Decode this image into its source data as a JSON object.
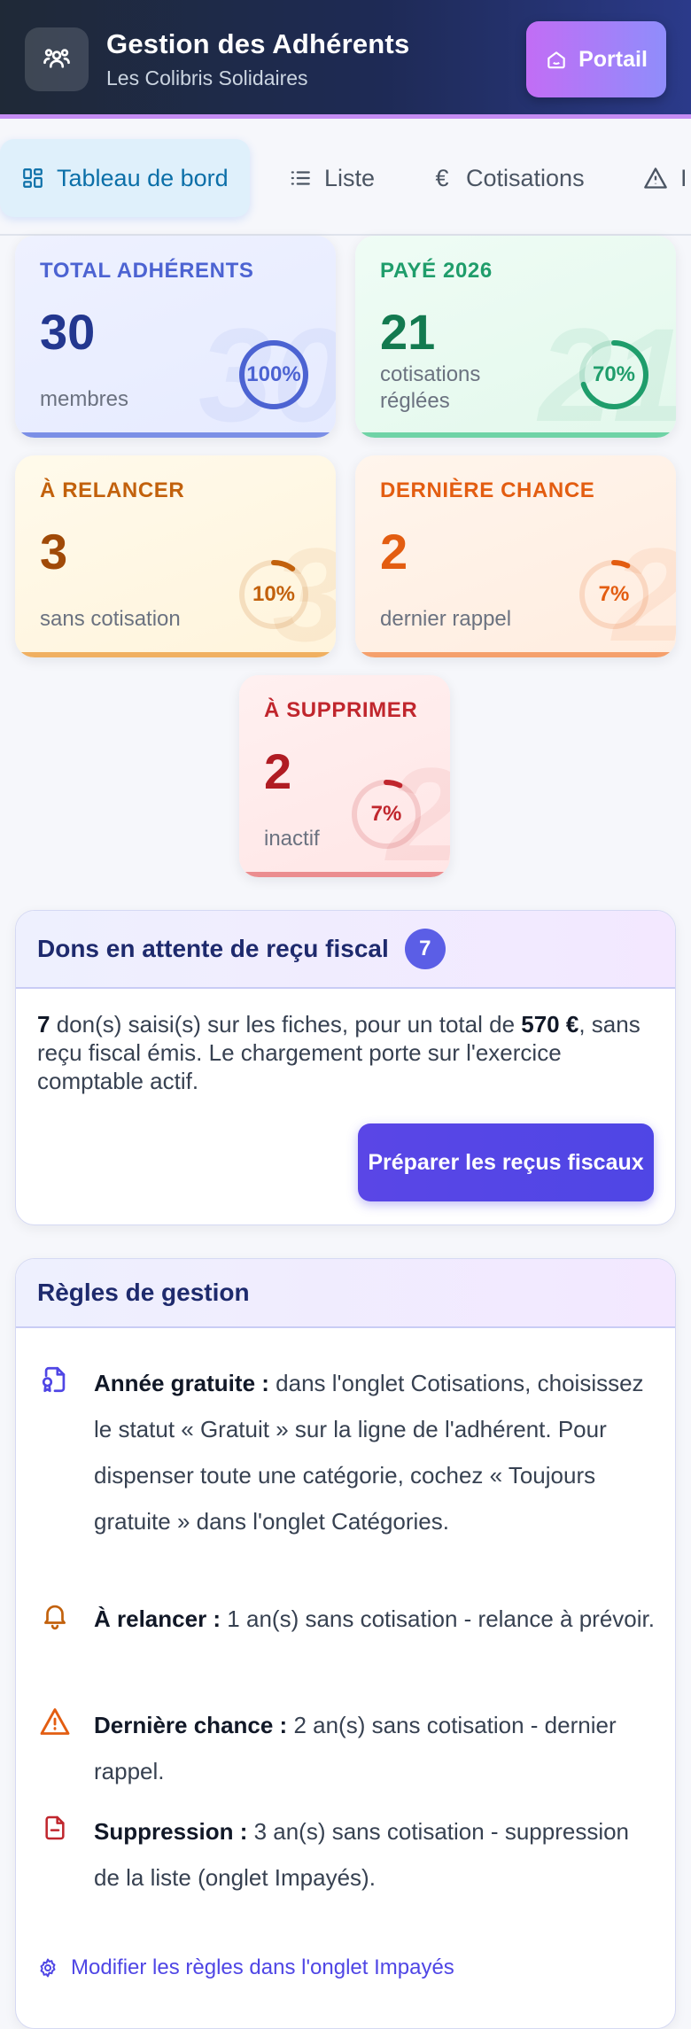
{
  "header": {
    "title": "Gestion des Adhérents",
    "subtitle": "Les Colibris Solidaires",
    "portal_label": "Portail"
  },
  "tabs": [
    {
      "label": "Tableau de bord",
      "icon": "dashboard-icon",
      "active": true
    },
    {
      "label": "Liste",
      "icon": "list-icon",
      "active": false
    },
    {
      "label": "Cotisations",
      "icon": "euro-icon",
      "active": false
    },
    {
      "label": "I",
      "icon": "warning-icon",
      "active": false
    }
  ],
  "stats": {
    "total": {
      "title": "TOTAL ADHÉRENTS",
      "value": "30",
      "label": "membres",
      "percent": 100,
      "percent_label": "100%",
      "color": "#4c63d2"
    },
    "paid": {
      "title": "PAYÉ 2026",
      "value": "21",
      "label": "cotisations réglées",
      "percent": 70,
      "percent_label": "70%",
      "color": "#1f9d6b"
    },
    "remind": {
      "title": "À RELANCER",
      "value": "3",
      "label": "sans cotisation",
      "percent": 10,
      "percent_label": "10%",
      "color": "#c2610c"
    },
    "last": {
      "title": "DERNIÈRE CHANCE",
      "value": "2",
      "label": "dernier rappel",
      "percent": 7,
      "percent_label": "7%",
      "color": "#e35d11"
    },
    "delete": {
      "title": "À SUPPRIMER",
      "value": "2",
      "label": "inactif",
      "percent": 7,
      "percent_label": "7%",
      "color": "#c0262d"
    }
  },
  "donations": {
    "title": "Dons en attente de reçu fiscal",
    "badge": "7",
    "count": "7",
    "text_1": " don(s) saisi(s) sur les fiches, pour un total de ",
    "amount": "570 €",
    "text_2": ", sans reçu fiscal émis. Le chargement porte sur l'exercice comptable actif.",
    "button": "Préparer les reçus fiscaux"
  },
  "rules": {
    "title": "Règles de gestion",
    "items": [
      {
        "label": "Année gratuite :",
        "text": " dans l'onglet Cotisations, choisissez le statut « Gratuit » sur la ligne de l'adhérent. Pour dispenser toute une catégorie, cochez « Toujours gratuite » dans l'onglet Catégories.",
        "icon": "badge-document-icon",
        "color": "#4f46e5"
      },
      {
        "label": "À relancer :",
        "text": " 1 an(s) sans cotisation - relance à prévoir.",
        "icon": "bell-icon",
        "color": "#c2610c"
      },
      {
        "label": "Dernière chance :",
        "text": " 2 an(s) sans cotisation - dernier rappel.",
        "icon": "warning-icon",
        "color": "#e35d11"
      },
      {
        "label": "Suppression :",
        "text": " 3 an(s) sans cotisation - suppression de la liste (onglet Impayés).",
        "icon": "file-minus-icon",
        "color": "#c0262d"
      }
    ],
    "link": "Modifier les règles dans l'onglet Impayés"
  }
}
